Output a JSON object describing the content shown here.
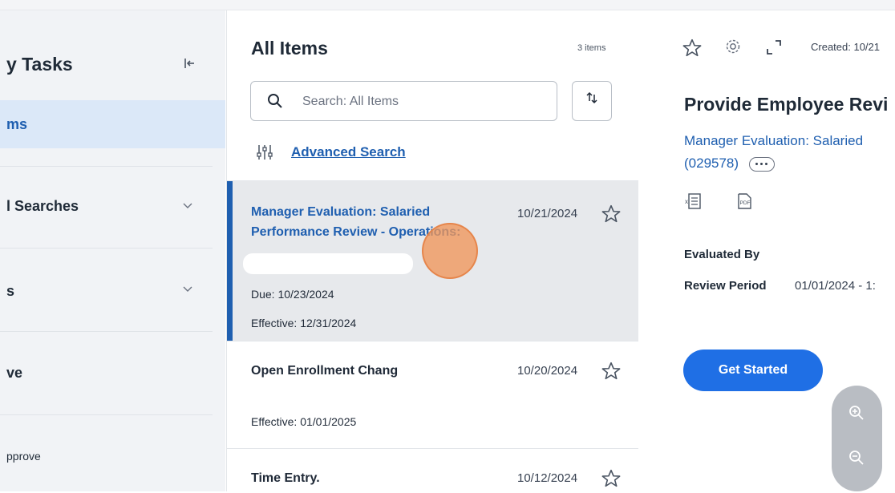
{
  "sidebar": {
    "title": "y Tasks",
    "items": [
      {
        "label": "ms"
      },
      {
        "label": "l Searches"
      },
      {
        "label": "s"
      },
      {
        "label": "ve"
      },
      {
        "label": "pprove"
      }
    ]
  },
  "list": {
    "title": "All Items",
    "count": "3 items",
    "search_placeholder": "Search: All Items",
    "advanced_search": "Advanced Search",
    "rows": [
      {
        "title": "Manager Evaluation: Salaried Performance Review - Operations:",
        "date": "10/21/2024",
        "due": "Due: 10/23/2024",
        "effective": "Effective: 12/31/2024"
      },
      {
        "title": "Open Enrollment Chang",
        "date": "10/20/2024",
        "effective": "Effective: 01/01/2025"
      },
      {
        "title": "Time Entry.",
        "date": "10/12/2024"
      }
    ]
  },
  "detail": {
    "created": "Created: 10/21",
    "title": "Provide Employee Revi",
    "link_line1": "Manager Evaluation: Salaried",
    "link_line2": "(029578)",
    "evaluated_by_label": "Evaluated By",
    "review_period_label": "Review Period",
    "review_period_value": "01/01/2024 - 1:",
    "get_started": "Get Started"
  },
  "colors": {
    "accent": "#1f5fb0",
    "primary_button": "#1f6fe5",
    "selected_row": "#e7e9ec",
    "sidebar_active": "#dbe8f8"
  }
}
